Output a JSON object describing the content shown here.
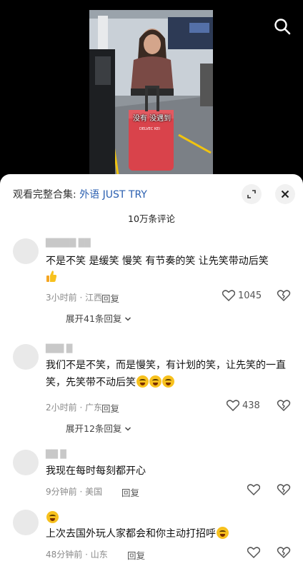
{
  "video": {
    "subtitle": "没有 没遇到",
    "suitcase_tag": "DELVEC ΚΕΙ"
  },
  "panel": {
    "collection_prefix": "观看完整合集:",
    "collection_name": "外语 JUST TRY",
    "comment_count": "10万条评论"
  },
  "comments": [
    {
      "text": "不是不笑 是缓笑 慢笑 有节奏的笑 让先笑带动后笑",
      "time": "3小时前",
      "location": "江西",
      "reply_label": "回复",
      "likes": "1045",
      "expand": "展开41条回复"
    },
    {
      "text": "我们不是不笑，而是慢笑，有计划的笑，让先笑的一直笑，先笑带不动后笑",
      "time": "2小时前",
      "location": "广东",
      "reply_label": "回复",
      "likes": "438",
      "expand": "展开12条回复"
    },
    {
      "text": "我现在每时每刻都开心",
      "time": "9分钟前",
      "location": "美国",
      "reply_label": "回复"
    },
    {
      "text": "上次去国外玩人家都会和你主动打招呼",
      "time": "48分钟前",
      "location": "山东",
      "reply_label": "回复"
    }
  ],
  "colors": {
    "accent_link": "#2a5fb0",
    "emoji": "#f7c11e"
  }
}
